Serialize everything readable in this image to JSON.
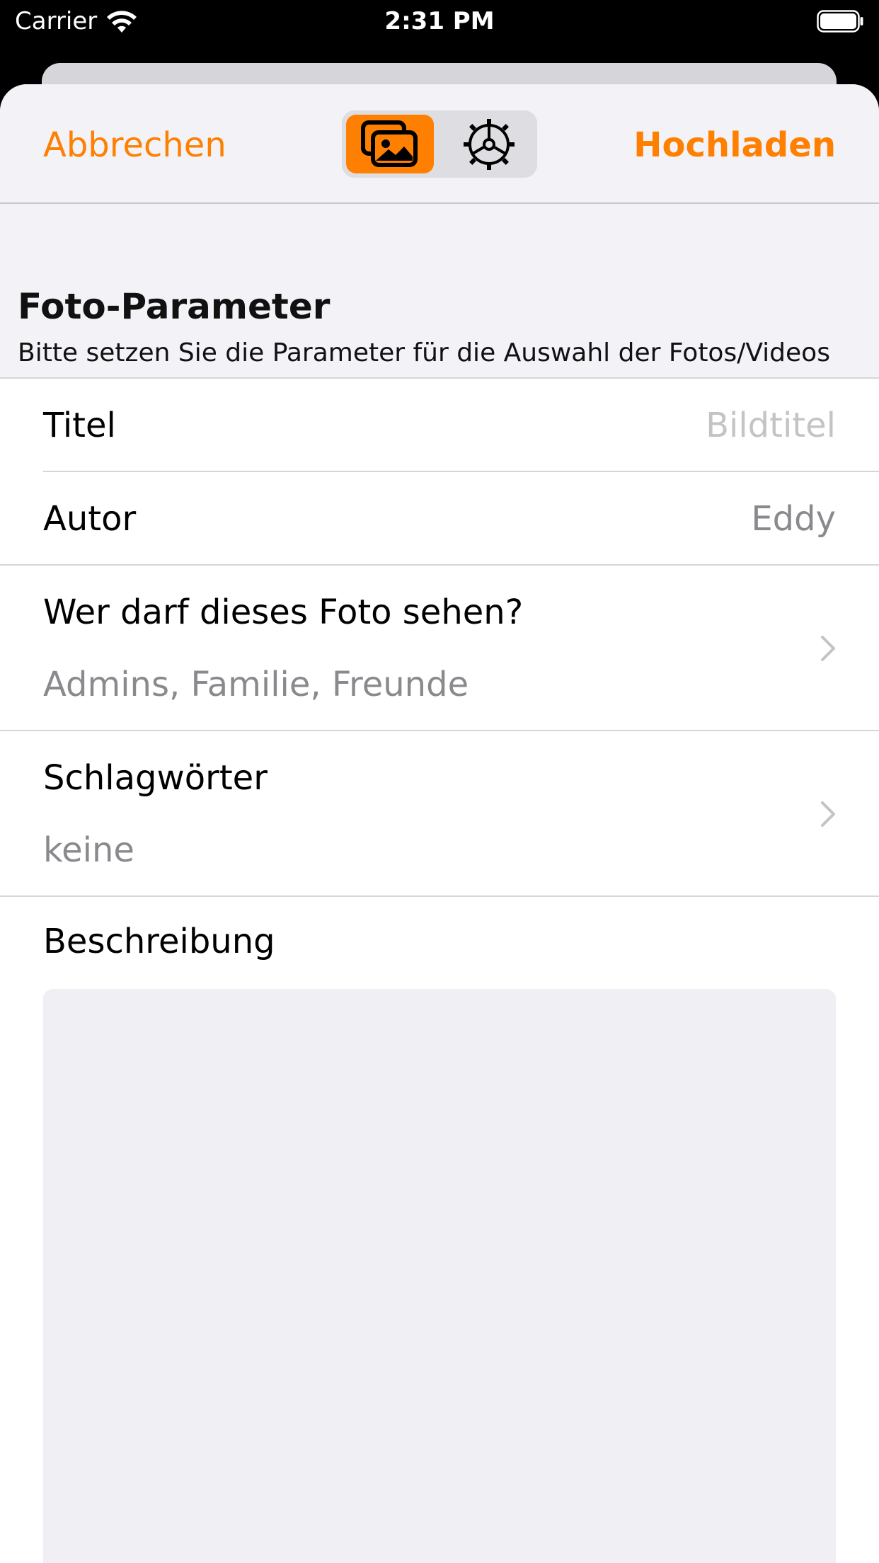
{
  "status_bar": {
    "carrier": "Carrier",
    "time": "2:31 PM"
  },
  "nav": {
    "cancel_label": "Abbrechen",
    "upload_label": "Hochladen",
    "segments": [
      {
        "icon": "photos-icon",
        "selected": true
      },
      {
        "icon": "gear-icon",
        "selected": false
      }
    ]
  },
  "section": {
    "title": "Foto-Parameter",
    "subtitle": "Bitte setzen Sie die Parameter für die Auswahl der Fotos/Videos"
  },
  "form": {
    "title_label": "Titel",
    "title_placeholder": "Bildtitel",
    "author_label": "Autor",
    "author_value": "Eddy",
    "visibility_label": "Wer darf dieses Foto sehen?",
    "visibility_value": "Admins, Familie, Freunde",
    "tags_label": "Schlagwörter",
    "tags_value": "keine",
    "description_label": "Beschreibung",
    "description_value": ""
  },
  "colors": {
    "accent": "#ff7f00",
    "background": "#f2f2f7",
    "placeholder": "#c4c4c6",
    "secondary_text": "#8a8a8e"
  }
}
